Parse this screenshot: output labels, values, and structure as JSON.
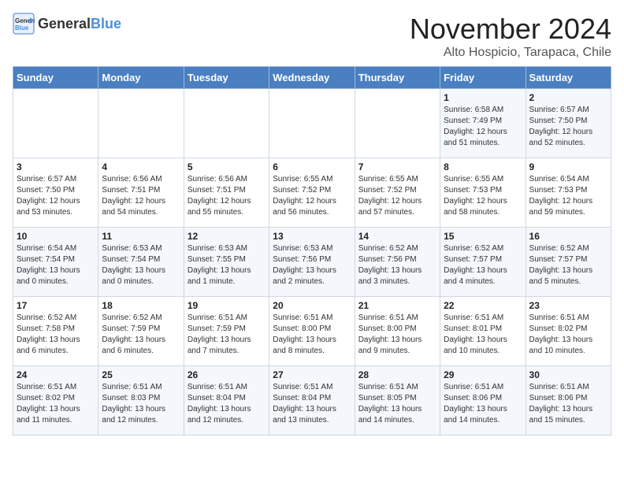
{
  "header": {
    "logo_general": "General",
    "logo_blue": "Blue",
    "month": "November 2024",
    "location": "Alto Hospicio, Tarapaca, Chile"
  },
  "weekdays": [
    "Sunday",
    "Monday",
    "Tuesday",
    "Wednesday",
    "Thursday",
    "Friday",
    "Saturday"
  ],
  "weeks": [
    [
      {
        "day": "",
        "info": ""
      },
      {
        "day": "",
        "info": ""
      },
      {
        "day": "",
        "info": ""
      },
      {
        "day": "",
        "info": ""
      },
      {
        "day": "",
        "info": ""
      },
      {
        "day": "1",
        "info": "Sunrise: 6:58 AM\nSunset: 7:49 PM\nDaylight: 12 hours\nand 51 minutes."
      },
      {
        "day": "2",
        "info": "Sunrise: 6:57 AM\nSunset: 7:50 PM\nDaylight: 12 hours\nand 52 minutes."
      }
    ],
    [
      {
        "day": "3",
        "info": "Sunrise: 6:57 AM\nSunset: 7:50 PM\nDaylight: 12 hours\nand 53 minutes."
      },
      {
        "day": "4",
        "info": "Sunrise: 6:56 AM\nSunset: 7:51 PM\nDaylight: 12 hours\nand 54 minutes."
      },
      {
        "day": "5",
        "info": "Sunrise: 6:56 AM\nSunset: 7:51 PM\nDaylight: 12 hours\nand 55 minutes."
      },
      {
        "day": "6",
        "info": "Sunrise: 6:55 AM\nSunset: 7:52 PM\nDaylight: 12 hours\nand 56 minutes."
      },
      {
        "day": "7",
        "info": "Sunrise: 6:55 AM\nSunset: 7:52 PM\nDaylight: 12 hours\nand 57 minutes."
      },
      {
        "day": "8",
        "info": "Sunrise: 6:55 AM\nSunset: 7:53 PM\nDaylight: 12 hours\nand 58 minutes."
      },
      {
        "day": "9",
        "info": "Sunrise: 6:54 AM\nSunset: 7:53 PM\nDaylight: 12 hours\nand 59 minutes."
      }
    ],
    [
      {
        "day": "10",
        "info": "Sunrise: 6:54 AM\nSunset: 7:54 PM\nDaylight: 13 hours\nand 0 minutes."
      },
      {
        "day": "11",
        "info": "Sunrise: 6:53 AM\nSunset: 7:54 PM\nDaylight: 13 hours\nand 0 minutes."
      },
      {
        "day": "12",
        "info": "Sunrise: 6:53 AM\nSunset: 7:55 PM\nDaylight: 13 hours\nand 1 minute."
      },
      {
        "day": "13",
        "info": "Sunrise: 6:53 AM\nSunset: 7:56 PM\nDaylight: 13 hours\nand 2 minutes."
      },
      {
        "day": "14",
        "info": "Sunrise: 6:52 AM\nSunset: 7:56 PM\nDaylight: 13 hours\nand 3 minutes."
      },
      {
        "day": "15",
        "info": "Sunrise: 6:52 AM\nSunset: 7:57 PM\nDaylight: 13 hours\nand 4 minutes."
      },
      {
        "day": "16",
        "info": "Sunrise: 6:52 AM\nSunset: 7:57 PM\nDaylight: 13 hours\nand 5 minutes."
      }
    ],
    [
      {
        "day": "17",
        "info": "Sunrise: 6:52 AM\nSunset: 7:58 PM\nDaylight: 13 hours\nand 6 minutes."
      },
      {
        "day": "18",
        "info": "Sunrise: 6:52 AM\nSunset: 7:59 PM\nDaylight: 13 hours\nand 6 minutes."
      },
      {
        "day": "19",
        "info": "Sunrise: 6:51 AM\nSunset: 7:59 PM\nDaylight: 13 hours\nand 7 minutes."
      },
      {
        "day": "20",
        "info": "Sunrise: 6:51 AM\nSunset: 8:00 PM\nDaylight: 13 hours\nand 8 minutes."
      },
      {
        "day": "21",
        "info": "Sunrise: 6:51 AM\nSunset: 8:00 PM\nDaylight: 13 hours\nand 9 minutes."
      },
      {
        "day": "22",
        "info": "Sunrise: 6:51 AM\nSunset: 8:01 PM\nDaylight: 13 hours\nand 10 minutes."
      },
      {
        "day": "23",
        "info": "Sunrise: 6:51 AM\nSunset: 8:02 PM\nDaylight: 13 hours\nand 10 minutes."
      }
    ],
    [
      {
        "day": "24",
        "info": "Sunrise: 6:51 AM\nSunset: 8:02 PM\nDaylight: 13 hours\nand 11 minutes."
      },
      {
        "day": "25",
        "info": "Sunrise: 6:51 AM\nSunset: 8:03 PM\nDaylight: 13 hours\nand 12 minutes."
      },
      {
        "day": "26",
        "info": "Sunrise: 6:51 AM\nSunset: 8:04 PM\nDaylight: 13 hours\nand 12 minutes."
      },
      {
        "day": "27",
        "info": "Sunrise: 6:51 AM\nSunset: 8:04 PM\nDaylight: 13 hours\nand 13 minutes."
      },
      {
        "day": "28",
        "info": "Sunrise: 6:51 AM\nSunset: 8:05 PM\nDaylight: 13 hours\nand 14 minutes."
      },
      {
        "day": "29",
        "info": "Sunrise: 6:51 AM\nSunset: 8:06 PM\nDaylight: 13 hours\nand 14 minutes."
      },
      {
        "day": "30",
        "info": "Sunrise: 6:51 AM\nSunset: 8:06 PM\nDaylight: 13 hours\nand 15 minutes."
      }
    ]
  ]
}
